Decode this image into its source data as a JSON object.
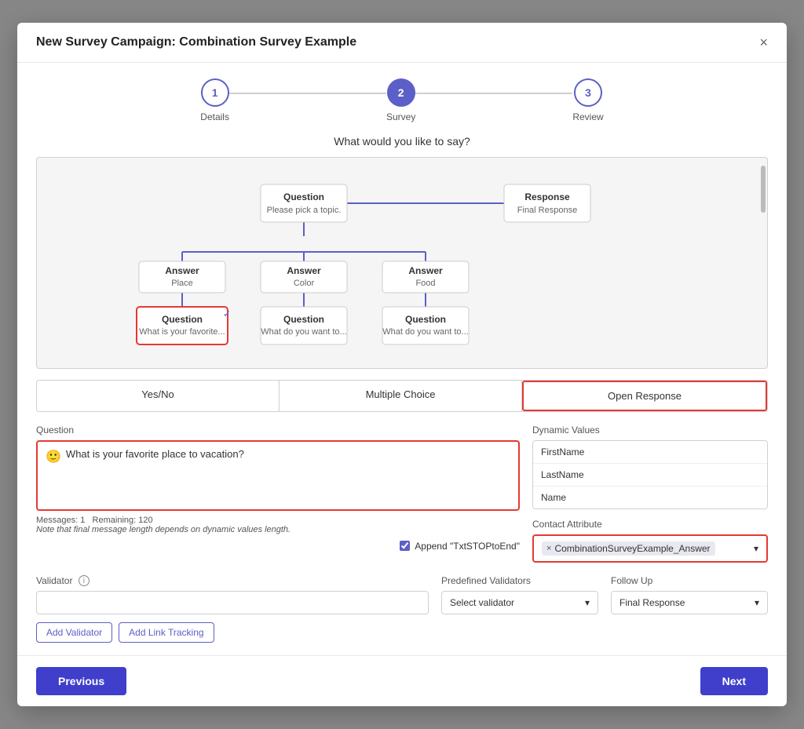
{
  "modal": {
    "title": "New Survey Campaign: Combination Survey Example",
    "close_label": "×"
  },
  "stepper": {
    "steps": [
      {
        "number": "1",
        "label": "Details",
        "state": "inactive"
      },
      {
        "number": "2",
        "label": "Survey",
        "state": "active"
      },
      {
        "number": "3",
        "label": "Review",
        "state": "inactive"
      }
    ]
  },
  "section_title": "What would you like to say?",
  "tree": {
    "nodes": [
      {
        "id": "q1",
        "title": "Question",
        "sub": "Please pick a topic.",
        "type": "question"
      },
      {
        "id": "r1",
        "title": "Response",
        "sub": "Final Response",
        "type": "response"
      },
      {
        "id": "a1",
        "title": "Answer",
        "sub": "Place",
        "type": "answer"
      },
      {
        "id": "a2",
        "title": "Answer",
        "sub": "Color",
        "type": "answer"
      },
      {
        "id": "a3",
        "title": "Answer",
        "sub": "Food",
        "type": "answer"
      },
      {
        "id": "q2",
        "title": "Question",
        "sub": "What is your favorite...",
        "type": "question",
        "selected": true
      },
      {
        "id": "q3",
        "title": "Question",
        "sub": "What do you want to...",
        "type": "question"
      },
      {
        "id": "q4",
        "title": "Question",
        "sub": "What do you want to...",
        "type": "question"
      }
    ]
  },
  "type_tabs": [
    {
      "label": "Yes/No",
      "active": false
    },
    {
      "label": "Multiple Choice",
      "active": false
    },
    {
      "label": "Open Response",
      "active": true
    }
  ],
  "question_field": {
    "label": "Question",
    "value": "What is your favorite place to vacation?",
    "emoji": "🙂"
  },
  "messages": {
    "count": "Messages: 1",
    "remaining": "Remaining: 120",
    "note": "Note that final message length depends on dynamic values length."
  },
  "append_txt_stop": {
    "label": "Append \"TxtSTOPtoEnd\"",
    "checked": true
  },
  "dynamic_values": {
    "label": "Dynamic Values",
    "items": [
      "FirstName",
      "LastName",
      "Name"
    ]
  },
  "contact_attribute": {
    "label": "Contact Attribute",
    "value": "CombinationSurveyExample_Answer"
  },
  "validator": {
    "label": "Validator",
    "placeholder": "",
    "add_btn": "Add Validator",
    "link_btn": "Add Link Tracking"
  },
  "predefined": {
    "label": "Predefined Validators",
    "placeholder": "Select validator"
  },
  "followup": {
    "label": "Follow Up",
    "value": "Final Response"
  },
  "footer": {
    "previous_label": "Previous",
    "next_label": "Next"
  }
}
